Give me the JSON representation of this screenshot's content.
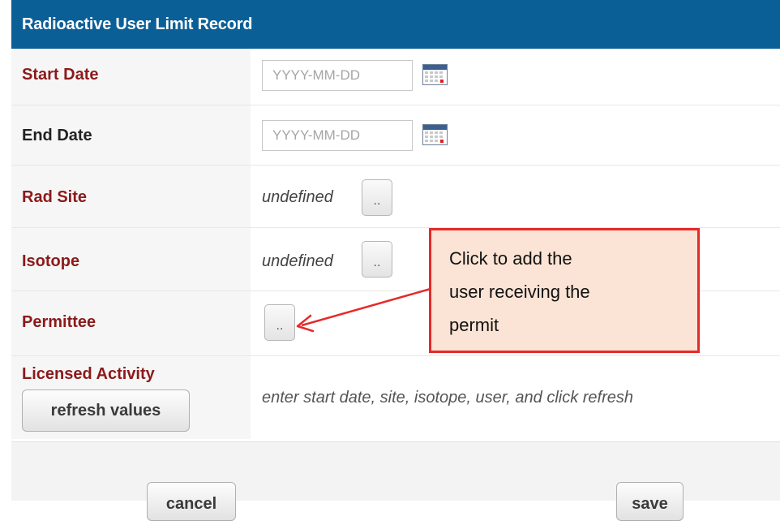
{
  "header": {
    "title": "Radioactive User Limit Record"
  },
  "form": {
    "start_date": {
      "label": "Start Date",
      "placeholder": "YYYY-MM-DD",
      "value": ""
    },
    "end_date": {
      "label": "End Date",
      "placeholder": "YYYY-MM-DD",
      "value": ""
    },
    "rad_site": {
      "label": "Rad Site",
      "value": "undefined",
      "picker_label": ".."
    },
    "isotope": {
      "label": "Isotope",
      "value": "undefined",
      "picker_label": ".."
    },
    "permittee": {
      "label": "Permittee",
      "picker_label": ".."
    },
    "licensed_activity": {
      "label": "Licensed Activity",
      "refresh_label": "refresh values",
      "hint": "enter start date, site, isotope, user, and click refresh"
    }
  },
  "footer": {
    "cancel_label": "cancel",
    "save_label": "save"
  },
  "callout": {
    "lines": [
      "Click to add the",
      "user receiving the",
      "permit"
    ]
  },
  "colors": {
    "header_bg": "#0b5f97",
    "required_label": "#8b1a1a",
    "callout_border": "#e52a2a",
    "callout_bg": "#fbe4d5"
  }
}
